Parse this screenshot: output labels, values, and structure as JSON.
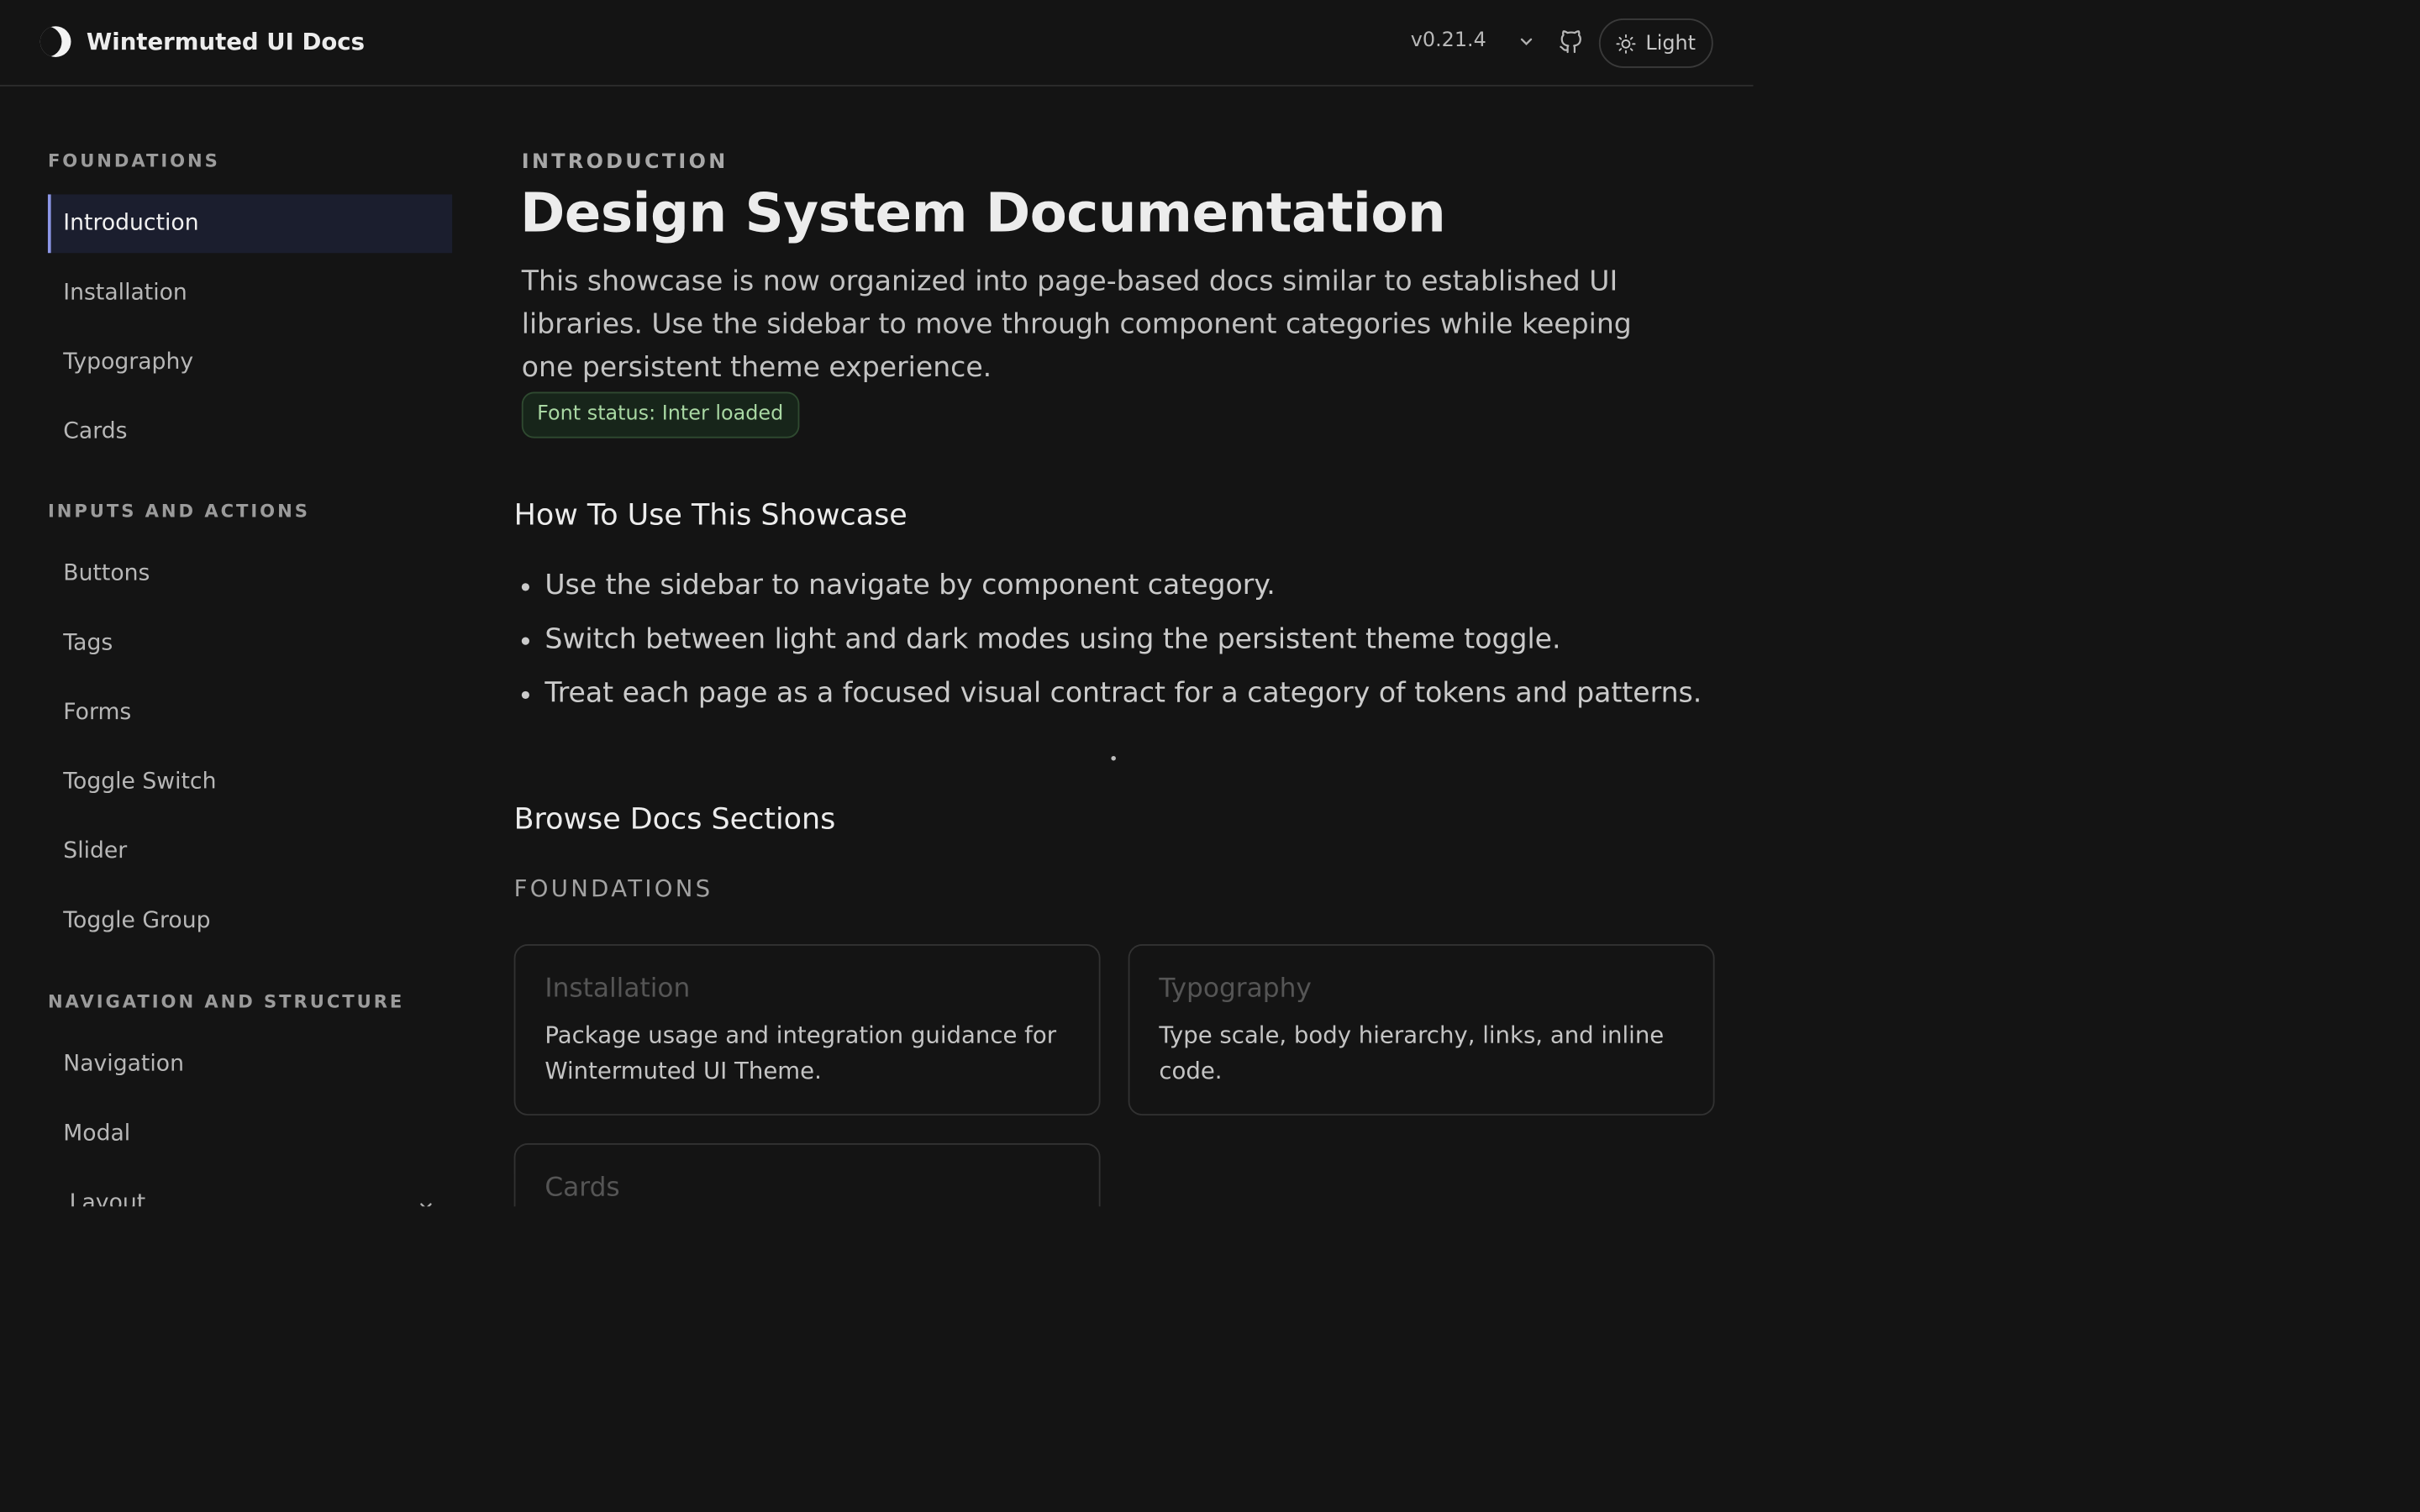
{
  "header": {
    "app_title": "Wintermuted UI Docs",
    "version": "v0.21.4",
    "theme_toggle_label": "Light",
    "icons": [
      "moon-logo-icon",
      "chevron-down-icon",
      "github-icon",
      "sun-icon"
    ]
  },
  "sidebar": {
    "groups": [
      {
        "label": "FOUNDATIONS",
        "items": [
          "Introduction",
          "Installation",
          "Typography",
          "Cards"
        ]
      },
      {
        "label": "INPUTS AND ACTIONS",
        "items": [
          "Buttons",
          "Tags",
          "Forms",
          "Toggle Switch",
          "Slider",
          "Toggle Group"
        ]
      },
      {
        "label": "NAVIGATION AND STRUCTURE",
        "items": [
          "Navigation",
          "Modal",
          "Layout"
        ]
      }
    ],
    "active_item": "Introduction"
  },
  "main": {
    "eyebrow": "INTRODUCTION",
    "title": "Design System Documentation",
    "lead": "This showcase is now organized into page-based docs similar to established UI libraries. Use the sidebar to move through component categories while keeping one persistent theme experience.",
    "font_badge": "Font status: Inter loaded",
    "how_to_heading": "How To Use This Showcase",
    "how_to_items": [
      "Use the sidebar to navigate by component category.",
      "Switch between light and dark modes using the persistent theme toggle.",
      "Treat each page as a focused visual contract for a category of tokens and patterns."
    ],
    "browse_heading": "Browse Docs Sections",
    "browse_group_label": "FOUNDATIONS",
    "cards": [
      {
        "title": "Installation",
        "description": "Package usage and integration guidance for Wintermuted UI Theme."
      },
      {
        "title": "Typography",
        "description": "Type scale, body hierarchy, links, and inline code."
      },
      {
        "title": "Cards",
        "description": ""
      }
    ]
  },
  "colors": {
    "background": "#141414",
    "accent": "#8c96e6",
    "active_nav_bg": "#1b1e2e",
    "badge_text": "#a9d8a3",
    "border": "#323232"
  }
}
